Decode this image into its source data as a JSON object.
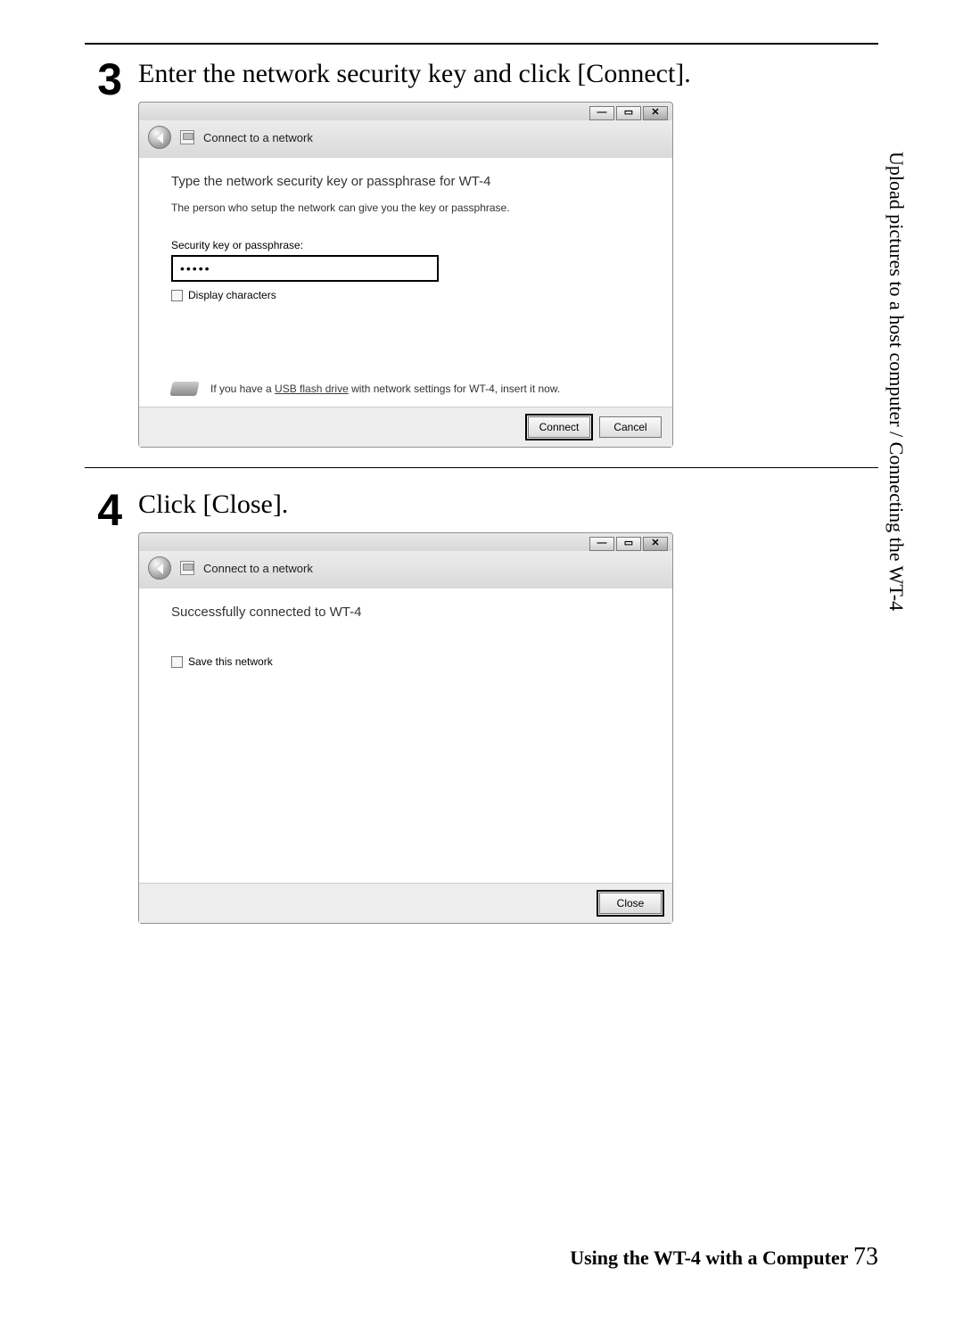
{
  "steps": {
    "s3": {
      "num": "3",
      "title": "Enter the network security key and click [Connect]."
    },
    "s4": {
      "num": "4",
      "title": "Click [Close]."
    }
  },
  "win1": {
    "title": "Connect to a network",
    "heading": "Type the network security key or passphrase for WT-4",
    "sub": "The person who setup the network can give you the key or passphrase.",
    "input_label": "Security key or passphrase:",
    "input_value": "•••••",
    "display_chars": "Display characters",
    "usb_pre": "If you have a ",
    "usb_link": "USB flash drive",
    "usb_post": " with network settings for WT-4, insert it now.",
    "connect": "Connect",
    "cancel": "Cancel",
    "ctrl_min": "—",
    "ctrl_max": "▭",
    "ctrl_close": "✕"
  },
  "win2": {
    "title": "Connect to a network",
    "heading": "Successfully connected to WT-4",
    "save": "Save this network",
    "close": "Close",
    "ctrl_min": "—",
    "ctrl_max": "▭",
    "ctrl_close": "✕"
  },
  "side": "Upload pictures to a host computer / Connecting the WT-4",
  "footer": {
    "text": "Using the WT-4 with a Computer",
    "page": "73"
  }
}
